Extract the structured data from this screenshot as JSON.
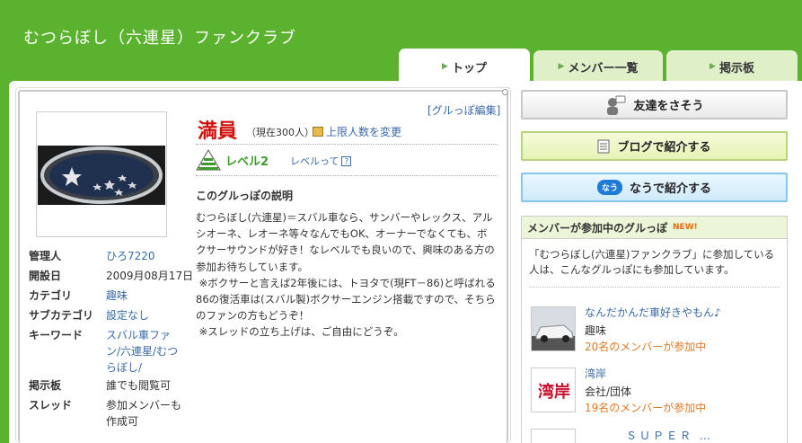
{
  "site": {
    "title": "むつらぼし（六連星）ファンクラブ"
  },
  "tabs": [
    {
      "label": "トップ"
    },
    {
      "label": "メンバー一覧"
    },
    {
      "label": "掲示板"
    }
  ],
  "profile": {
    "edit_link": "[グルっぽ編集]",
    "status": "満員",
    "status_count": "（現在300人）",
    "limit_link": "上限人数を変更",
    "level": "レベル2",
    "level_link": "レベルって",
    "desc_title": "このグルっぽの説明",
    "description": "むつらぼし(六連星)＝スバル車なら、サンバーやレックス、アルシオーネ、レオーネ等々なんでもOK、オーナーでなくても、ボクサーサウンドが好き！なレベルでも良いので、興味のある方の参加お待ちしています。\n ※ボクサーと言えば2年後には、トヨタで(現FT－86)と呼ばれる86の復活車は(スバル製)ボクサーエンジン搭載ですので、そちらのファンの方もどうぞ！\n ※スレッドの立ち上げは、ご自由にどうぞ。"
  },
  "info": {
    "admin_label": "管理人",
    "admin_value": "ひろ7220",
    "opened_label": "開設日",
    "opened_value": "2009月08月17日",
    "category_label": "カテゴリ",
    "category_value": "趣味",
    "subcategory_label": "サブカテゴリ",
    "subcategory_value": "設定なし",
    "keyword_label": "キーワード",
    "keyword_value": "スバル車ファン/六連星/むつらぼし/",
    "board_label": "掲示板",
    "board_value": "誰でも閲覧可",
    "thread_label": "スレッド",
    "thread_value": "参加メンバーも作成可"
  },
  "actions": {
    "invite": "友達をさそう",
    "blog": "ブログで紹介する",
    "nau_badge": "なう",
    "nau": "なうで紹介する"
  },
  "sidebar": {
    "heading": "メンバーが参加中のグルっぽ",
    "new_badge": "NEW!",
    "intro": "「むつらぼし(六連星)ファンクラブ」に参加している人は、こんなグルっぽにも参加しています。",
    "groups": [
      {
        "name": "なんだかんだ車好きやもん♪",
        "category": "趣味",
        "count": "20名のメンバーが参加中"
      },
      {
        "name": "湾岸",
        "category": "会社/団体",
        "count": "19名のメンバーが参加中"
      }
    ],
    "thumb2_text": "湾岸",
    "bottom_text": "ＳＵＰＥＲ …"
  },
  "colors": {
    "brand_green": "#5bb22e",
    "status_red": "#d0100a",
    "link_blue": "#3a6aa8",
    "count_orange": "#e27a24"
  }
}
